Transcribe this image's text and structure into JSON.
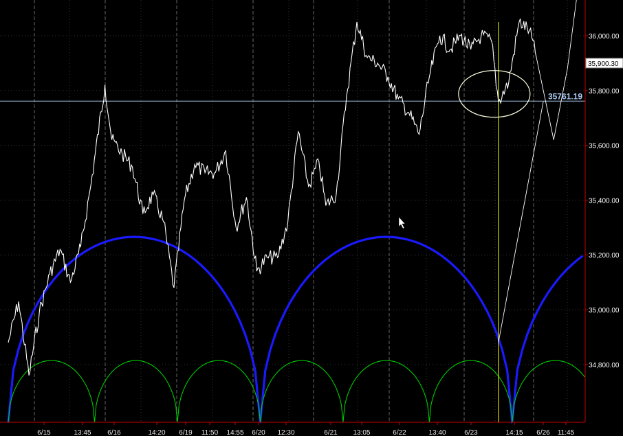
{
  "chart_data": {
    "type": "line",
    "title": "",
    "xlabel": "",
    "ylabel": "",
    "x_ticks": [
      "6/15",
      "13:45",
      "6/16",
      "14:20",
      "6/19",
      "11:50",
      "14:55",
      "6/20",
      "12:30",
      "6/21",
      "13:05",
      "6/22",
      "13:40",
      "6/23",
      "14:15",
      "6/26",
      "11:45"
    ],
    "y_ticks": [
      34800,
      35000,
      35200,
      35400,
      35600,
      35800,
      36000
    ],
    "y_tick_labels": [
      "34,800.00",
      "35,000.00",
      "35,200.00",
      "35,400.00",
      "35,600.00",
      "35,800.00",
      "36,000.00"
    ],
    "ylim": [
      34580,
      36180
    ],
    "grid": true,
    "last_price_label": "35,900.30",
    "horizontal_line": {
      "value": 35761.19,
      "label": "35761.19"
    },
    "series": [
      {
        "type": "price",
        "x": [
          0,
          0.3,
          0.6,
          0.9,
          1.2,
          1.5,
          1.8,
          2.1,
          2.4,
          2.8,
          3.0,
          3.3,
          3.6,
          3.9,
          4.2,
          4.5,
          4.8,
          5.1,
          5.4,
          5.7,
          6.0,
          6.3,
          6.6,
          6.9,
          7.2,
          7.5,
          7.8,
          8.1,
          8.4,
          8.7,
          9.0,
          9.2,
          9.5,
          9.8,
          10.1,
          10.4,
          10.7,
          11.0,
          11.3,
          11.6,
          11.9,
          12.2,
          12.5,
          12.8,
          13.1,
          13.4,
          13.7,
          14.0,
          14.2,
          14.5,
          14.8,
          15.1,
          15.3
        ],
        "y": [
          34880,
          35030,
          34760,
          34990,
          35130,
          35220,
          35100,
          35230,
          35460,
          35820,
          35620,
          35570,
          35520,
          35350,
          35420,
          35320,
          35080,
          35400,
          35530,
          35500,
          35500,
          35580,
          35300,
          35410,
          35140,
          35190,
          35190,
          35320,
          35650,
          35450,
          35540,
          35380,
          35420,
          35780,
          36050,
          35920,
          35900,
          35850,
          35770,
          35720,
          35640,
          35850,
          36000,
          35950,
          36000,
          35950,
          36000,
          35980,
          35760,
          35830,
          36050,
          36020,
          35920
        ],
        "color": "#ffffff"
      },
      {
        "type": "projection",
        "x": [
          15.3,
          15.8,
          16.2,
          16.5
        ],
        "y": [
          35920,
          35620,
          35880,
          36170
        ],
        "color": "#ffffff"
      },
      {
        "type": "trend",
        "x": [
          14.2,
          15.5
        ],
        "y": [
          34880,
          35760
        ],
        "color": "#ffffff"
      }
    ],
    "cycles": [
      {
        "name": "",
        "color": "#1a1aff",
        "troughs": [
          0,
          7.3,
          14.6
        ]
      },
      {
        "name": "",
        "color": "#00cc00",
        "troughs": [
          0,
          2.5,
          4.9,
          7.3,
          9.7,
          12.2,
          14.6
        ]
      }
    ],
    "vertical_marker": {
      "x": 14.2,
      "color": "#ffff00"
    },
    "highlight_ellipse": {
      "x": 14.2,
      "y": 35770,
      "color": "#ffffe0"
    },
    "colors": {
      "background": "#000000",
      "grid": "#555555",
      "axis": "#cc0000"
    }
  }
}
